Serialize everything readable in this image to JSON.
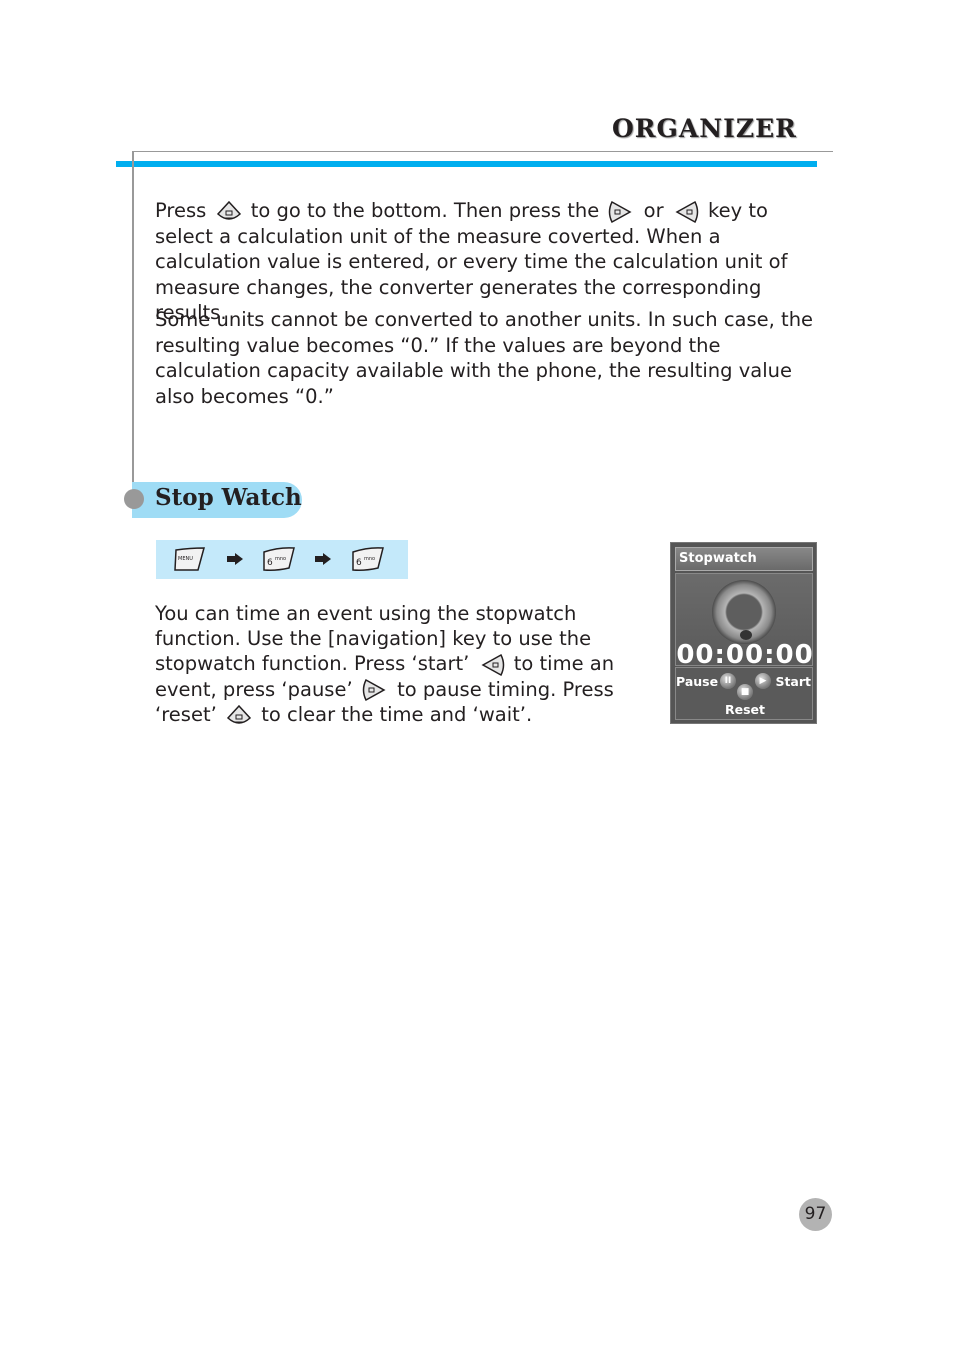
{
  "header": {
    "section_title": "ORGANIZER"
  },
  "intro": {
    "p1": {
      "t1": "Press",
      "k1": "down-key-icon",
      "t2": "to go to the bottom. Then press the",
      "k2": "left-key-icon",
      "t3": "or",
      "k3": "right-key-icon",
      "t4": "key to select a calculation unit of the measure coverted. When a calculation value is entered, or every time the calculation unit of measure changes, the converter generates the corresponding results."
    },
    "p2": "Some units cannot be converted to another units. In such case, the resulting value becomes “0.” If the values are beyond the calculation capacity available with the phone, the resulting value also becomes “0.”"
  },
  "section": {
    "title": "Stop Watch",
    "key_path": [
      {
        "label": "MENU",
        "icon": "menu-key-icon"
      },
      {
        "label": "6",
        "sub": "mno",
        "icon": "6-key-icon"
      },
      {
        "label": "6",
        "sub": "mno",
        "icon": "6-key-icon"
      }
    ],
    "body": {
      "t1": "You can time an event using the stopwatch function. Use the [navigation] key to use the stopwatch function. Press ‘start’",
      "t2": "to time an event, press ‘pause’",
      "t3": "to pause timing. Press ‘reset’",
      "t4": "to clear the time and ‘wait’."
    }
  },
  "phone_screen": {
    "title": "Stopwatch",
    "time": "00:00:00",
    "pause_label": "Pause",
    "start_label": "Start",
    "reset_label": "Reset",
    "pause_glyph": "II",
    "start_glyph": "▶",
    "reset_glyph": "■"
  },
  "footer": {
    "page_number": "97"
  },
  "colors": {
    "accent_blue": "#00aeef",
    "pill_blue": "#9fdcf5",
    "path_box": "#c4e9fa",
    "gray": "#999999"
  }
}
